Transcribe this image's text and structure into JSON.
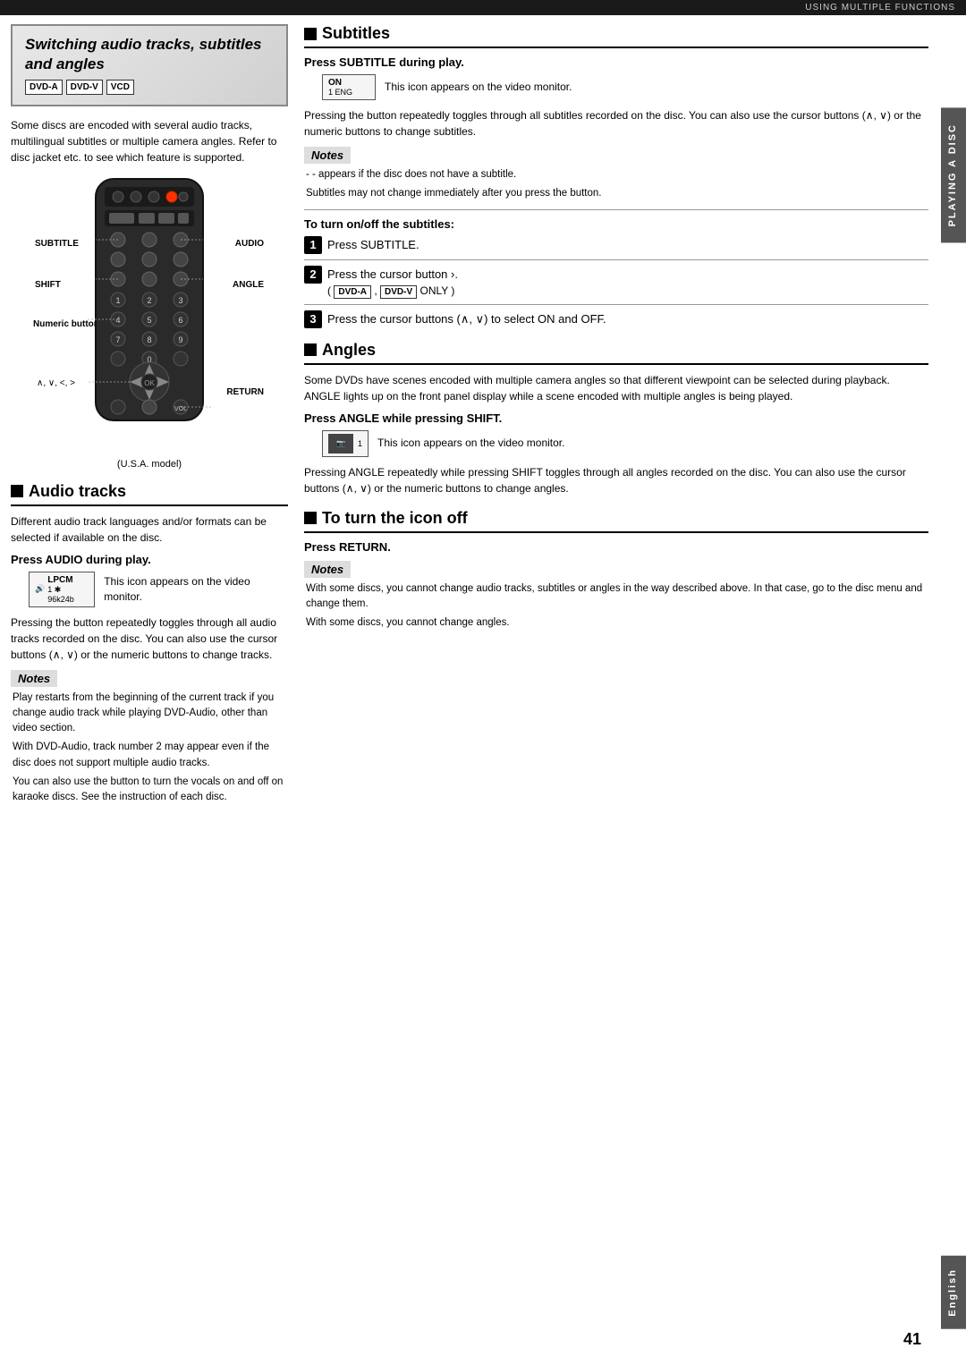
{
  "topBar": {
    "text": "USING MULTIPLE FUNCTIONS"
  },
  "sideTab": {
    "text": "PLAYING A DISC"
  },
  "bottomTab": {
    "text": "English"
  },
  "pageNumber": "41",
  "titleSection": {
    "title": "Switching audio tracks, subtitles and angles",
    "badges": [
      "DVD-A",
      "DVD-V",
      "VCD"
    ]
  },
  "introText": "Some discs are encoded with several audio tracks, multilingual subtitles or multiple camera angles. Refer to disc jacket etc. to see which feature is supported.",
  "remoteLabels": {
    "subtitle": "SUBTITLE",
    "audio": "AUDIO",
    "shift": "SHIFT",
    "angle": "ANGLE",
    "numeric": "Numeric buttons",
    "cursors": "∧, ∨, <, >",
    "return": "RETURN",
    "model": "(U.S.A. model)"
  },
  "audioTracksSection": {
    "title": "Audio tracks",
    "intro": "Different audio track languages and/or formats can be selected if available on the disc.",
    "pressAudio": "Press AUDIO during play.",
    "iconLabel": "LPCM",
    "iconSub": "1 ✱ 96k24b",
    "iconDesc": "This icon appears on the video monitor.",
    "bodyText": "Pressing the button repeatedly toggles through all audio tracks recorded on the disc. You can also use the cursor buttons (∧, ∨) or the numeric buttons to change tracks.",
    "notesLabel": "Notes",
    "notes": [
      "Play restarts from the beginning of the current track if you change audio track while playing DVD-Audio, other than video section.",
      "With DVD-Audio, track number 2 may appear even if the disc does not support multiple audio tracks.",
      "You can also use the button to turn the vocals on and off on karaoke discs. See the instruction of each disc."
    ]
  },
  "subtitlesSection": {
    "title": "Subtitles",
    "pressSub": "Press SUBTITLE during play.",
    "iconLabel": "ON",
    "iconSub": "1 ENG",
    "iconDesc": "This icon appears on the video monitor.",
    "bodyText": "Pressing the button repeatedly toggles through all subtitles recorded on the disc. You can also use the cursor buttons (∧, ∨) or the numeric buttons to change subtitles.",
    "notesLabel": "Notes",
    "notes": [
      "- - appears if the disc does not have a subtitle.",
      "Subtitles may not change immediately after you press the button."
    ],
    "turnOnOffTitle": "To turn on/off the subtitles:",
    "steps": [
      {
        "num": "1",
        "text": "Press SUBTITLE."
      },
      {
        "num": "2",
        "text": "Press the cursor button ›.",
        "sub": "( DVD-A ,  DVD-V  ONLY)"
      },
      {
        "num": "3",
        "text": "Press the cursor buttons (∧, ∨) to select ON and OFF."
      }
    ]
  },
  "anglesSection": {
    "title": "Angles",
    "bodyText": "Some DVDs have scenes encoded with multiple camera angles so that different viewpoint can be selected during playback. ANGLE lights up on the front panel display while a scene encoded with multiple angles is being played.",
    "pressAngle": "Press ANGLE while pressing SHIFT.",
    "iconDesc": "This icon appears on the video monitor.",
    "bodyText2": "Pressing ANGLE repeatedly while pressing SHIFT toggles through all angles recorded on the disc. You can also use the cursor buttons (∧, ∨) or the numeric buttons to change angles."
  },
  "iconOffSection": {
    "title": "To turn the icon off",
    "pressReturn": "Press RETURN.",
    "notesLabel": "Notes",
    "notes": [
      "With some discs, you cannot change audio tracks, subtitles or angles in the way described above. In that case, go to the disc menu and change them.",
      "With some discs, you cannot change angles."
    ]
  }
}
